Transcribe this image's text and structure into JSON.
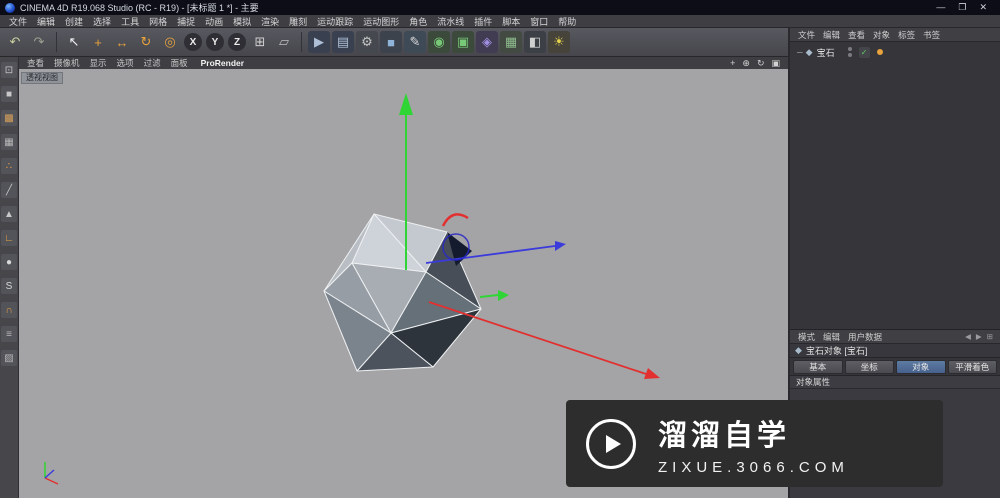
{
  "window": {
    "title": "CINEMA 4D R19.068 Studio (RC - R19) - [未标题 1 *] - 主要",
    "minimize": "—",
    "maximize": "❐",
    "close": "✕"
  },
  "menubar": {
    "items": [
      "文件",
      "编辑",
      "创建",
      "选择",
      "工具",
      "网格",
      "捕捉",
      "动画",
      "模拟",
      "渲染",
      "雕刻",
      "运动跟踪",
      "运动图形",
      "角色",
      "流水线",
      "插件",
      "脚本",
      "窗口",
      "帮助"
    ]
  },
  "toolbar": {
    "tools": [
      {
        "name": "undo-button",
        "glyph": "↶",
        "fg": "#c9cf9e"
      },
      {
        "name": "redo-button",
        "glyph": "↷",
        "fg": "#9aa08f"
      },
      {
        "type": "separator"
      },
      {
        "name": "live-selection-tool",
        "glyph": "↖",
        "fg": "#f2f2f2"
      },
      {
        "name": "move-tool",
        "glyph": "+",
        "fg": "#e8a33d"
      },
      {
        "name": "scale-tool",
        "glyph": "↔",
        "fg": "#e8a33d"
      },
      {
        "name": "rotate-tool",
        "glyph": "↻",
        "fg": "#e8a33d"
      },
      {
        "name": "last-used-tool",
        "glyph": "◎",
        "fg": "#e8a33d"
      },
      {
        "name": "x-axis-lock-toggle",
        "glyph": "X",
        "fg": "#ececec",
        "shape": "circle"
      },
      {
        "name": "y-axis-lock-toggle",
        "glyph": "Y",
        "fg": "#ececec",
        "shape": "circle"
      },
      {
        "name": "z-axis-lock-toggle",
        "glyph": "Z",
        "fg": "#ececec",
        "shape": "circle"
      },
      {
        "name": "coordinate-system-toggle",
        "glyph": "⊞",
        "fg": "#cfcfcf"
      },
      {
        "name": "workplane-toggle",
        "glyph": "▱",
        "fg": "#bfbfbf"
      },
      {
        "type": "separator"
      },
      {
        "name": "render-view-button",
        "glyph": "▶",
        "fg": "#aebfd6",
        "bg": "#394150"
      },
      {
        "name": "render-picture-viewer-button",
        "glyph": "▤",
        "fg": "#aebfd6",
        "bg": "#394150"
      },
      {
        "name": "render-settings-button",
        "glyph": "⚙",
        "fg": "#c3c3c3",
        "bg": "#45484e"
      },
      {
        "name": "primitive-object-menu",
        "glyph": "■",
        "fg": "#8fb4d8",
        "bg": "#3c434c"
      },
      {
        "name": "spline-pen-menu",
        "glyph": "✎",
        "fg": "#dcdcdc",
        "bg": "#3f4a57"
      },
      {
        "name": "generators-menu",
        "glyph": "◉",
        "fg": "#77c877",
        "bg": "#3b4a3b"
      },
      {
        "name": "modeling-objects-menu",
        "glyph": "▣",
        "fg": "#77c877",
        "bg": "#3b4a3b"
      },
      {
        "name": "deformers-menu",
        "glyph": "◈",
        "fg": "#a08fe0",
        "bg": "#423c52"
      },
      {
        "name": "environment-menu",
        "glyph": "▦",
        "fg": "#8fbe8f",
        "bg": "#424a42"
      },
      {
        "name": "camera-menu",
        "glyph": "◧",
        "fg": "#cfcfcf",
        "bg": "#3c3f45"
      },
      {
        "name": "light-menu",
        "glyph": "☀",
        "fg": "#e8d44c",
        "bg": "#46443a"
      }
    ]
  },
  "mode_toolbar": {
    "items": [
      {
        "name": "make-editable-button",
        "glyph": "⊡",
        "fg": "#c8c8c8"
      },
      {
        "name": "model-mode-button",
        "glyph": "■",
        "fg": "#c8c8c8"
      },
      {
        "name": "texture-mode-button",
        "glyph": "▩",
        "fg": "#d7a15a"
      },
      {
        "name": "workplane-mode-button",
        "glyph": "▦",
        "fg": "#b8b8b8"
      },
      {
        "name": "points-mode-button",
        "glyph": "∴",
        "fg": "#e8a33d"
      },
      {
        "name": "edges-mode-button",
        "glyph": "╱",
        "fg": "#c8c8c8"
      },
      {
        "name": "polygons-mode-button",
        "glyph": "▲",
        "fg": "#c8c8c8"
      },
      {
        "name": "axis-mode-button",
        "glyph": "∟",
        "fg": "#e8a33d"
      },
      {
        "name": "viewport-select-button",
        "glyph": "●",
        "fg": "#d8d8d8"
      },
      {
        "name": "soft-selection-button",
        "glyph": "S",
        "fg": "#d8d8d8"
      },
      {
        "name": "snap-toggle-button",
        "glyph": "∩",
        "fg": "#e8a33d"
      },
      {
        "name": "quantize-button",
        "glyph": "≡",
        "fg": "#b8b8b8"
      },
      {
        "name": "workplane-lock-button",
        "glyph": "▨",
        "fg": "#b8b8b8"
      }
    ]
  },
  "viewport": {
    "menus": [
      "查看",
      "摄像机",
      "显示",
      "选项",
      "过滤",
      "面板"
    ],
    "prorender_label": "ProRender",
    "view_label": "透视视图",
    "controls": [
      {
        "name": "view-pan-control",
        "glyph": "+"
      },
      {
        "name": "view-dolly-control",
        "glyph": "⊕"
      },
      {
        "name": "view-rotate-control",
        "glyph": "↻"
      },
      {
        "name": "view-toggle-control",
        "glyph": "▣"
      }
    ]
  },
  "object_manager": {
    "menus": [
      "文件",
      "编辑",
      "查看",
      "对象",
      "标签",
      "书签"
    ],
    "check_glyph": "✓",
    "objects": [
      {
        "name": "宝石",
        "icon": "◆"
      }
    ]
  },
  "attribute_manager": {
    "menus": [
      "模式",
      "编辑",
      "用户数据"
    ],
    "nav_icons": [
      {
        "name": "am-history-back-icon",
        "glyph": "◀"
      },
      {
        "name": "am-history-forward-icon",
        "glyph": "▶"
      },
      {
        "name": "am-config-icon",
        "glyph": "⊞"
      }
    ],
    "title_icon": "◆",
    "title": "宝石对象 [宝石]",
    "tabs": [
      {
        "name": "tab-basic",
        "label": "基本",
        "state": ""
      },
      {
        "name": "tab-coordinates",
        "label": "坐标",
        "state": ""
      },
      {
        "name": "tab-object",
        "label": "对象",
        "state": "selected"
      },
      {
        "name": "tab-phong",
        "label": "平滑着色",
        "state": ""
      }
    ],
    "section_label": "对象属性"
  },
  "watermark": {
    "brand": "溜溜自学",
    "url": "ZIXUE.3066.COM"
  },
  "colors": {
    "axis_x": "#e23030",
    "axis_y": "#2fd435",
    "axis_z": "#3b3bdc",
    "accent_orange": "#e8a33d",
    "selected_tab_blue": "#46618c",
    "viewport_gray": "#a4a4a6"
  }
}
